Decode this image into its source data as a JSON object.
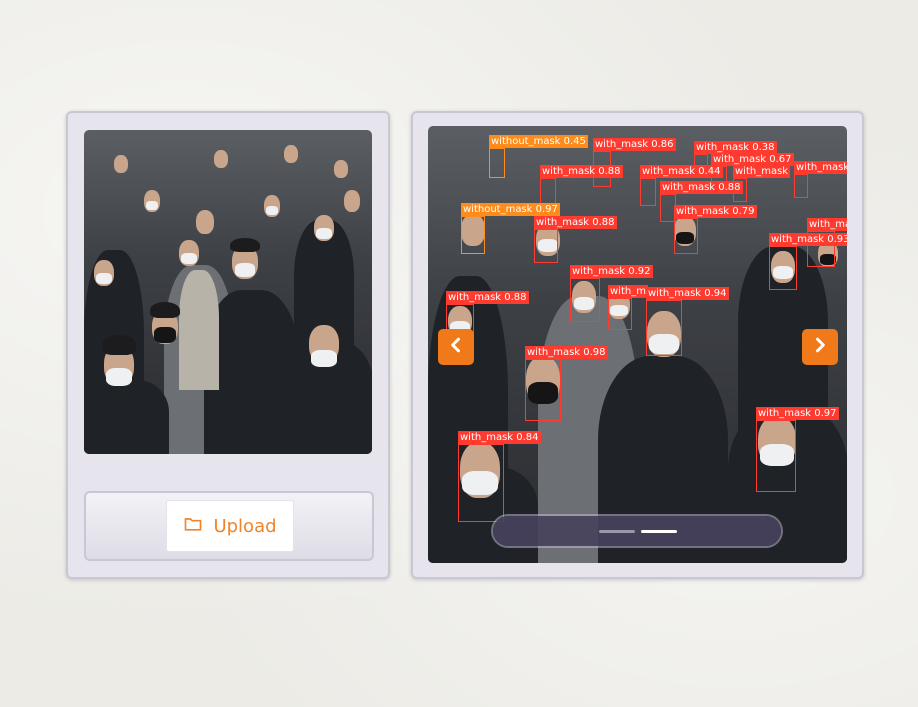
{
  "upload": {
    "label": "Upload",
    "icon": "folder-icon"
  },
  "gallery": {
    "current_index": 2,
    "total": 2,
    "prev_icon": "chevron-left-icon",
    "next_icon": "chevron-right-icon"
  },
  "colors": {
    "accent": "#f07a1a",
    "with_mask": "#ff3b30",
    "without_mask": "#ff8c1a",
    "panel": "#e6e5ee"
  },
  "detections": [
    {
      "label": "without_mask 0.45",
      "cls": "without_mask"
    },
    {
      "label": "with_mask 0.86",
      "cls": "with_mask"
    },
    {
      "label": "with_mask 0.38",
      "cls": "with_mask"
    },
    {
      "label": "with_mask 0.67",
      "cls": "with_mask"
    },
    {
      "label": "with_mask 0.88",
      "cls": "with_mask"
    },
    {
      "label": "with_mask 0.44",
      "cls": "with_mask"
    },
    {
      "label": "with_mask",
      "cls": "with_mask"
    },
    {
      "label": "with_mask",
      "cls": "with_mask"
    },
    {
      "label": "with_mask 0.88",
      "cls": "with_mask"
    },
    {
      "label": "without_mask 0.97",
      "cls": "without_mask"
    },
    {
      "label": "with_mask 0.79",
      "cls": "with_mask"
    },
    {
      "label": "with_mask 0.88",
      "cls": "with_mask"
    },
    {
      "label": "with_ma",
      "cls": "with_mask"
    },
    {
      "label": "with_mask 0.93",
      "cls": "with_mask"
    },
    {
      "label": "with_mask 0.92",
      "cls": "with_mask"
    },
    {
      "label": "with_mask 0.88",
      "cls": "with_mask"
    },
    {
      "label": "with_m",
      "cls": "with_mask"
    },
    {
      "label": "with_mask 0.94",
      "cls": "with_mask"
    },
    {
      "label": "with_mask 0.98",
      "cls": "with_mask"
    },
    {
      "label": "with_mask 0.97",
      "cls": "with_mask"
    },
    {
      "label": "with_mask 0.84",
      "cls": "with_mask"
    }
  ]
}
